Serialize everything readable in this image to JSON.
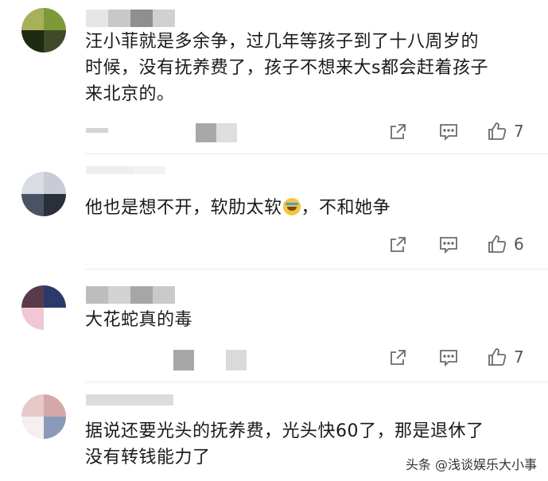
{
  "comments": [
    {
      "text_lines": [
        "汪小菲就是多余争，过几年等孩子到了十八周岁的",
        "时候，没有抚养费了，孩子不想来大s都会赶着孩子",
        "来北京的。"
      ],
      "likes": "7"
    },
    {
      "text_before": "他也是想不开，软肋太软",
      "text_after": "，不和她争",
      "emoji_icon": "crying-laughing-emoji",
      "likes": "6"
    },
    {
      "text_lines": [
        "大花蛇真的毒"
      ],
      "likes": "7"
    },
    {
      "text_lines": [
        "据说还要光头的抚养费，光头快60了，那是退休了",
        "没有转钱能力了"
      ]
    }
  ],
  "watermark": "头条 @浅谈娱乐大小事",
  "icons": {
    "share": "share-icon",
    "reply": "comment-icon",
    "like": "thumbs-up-icon"
  },
  "colors": {
    "icon": "#6b6b6b",
    "text": "#1a1a1a",
    "blur": "#9a9a9a"
  }
}
